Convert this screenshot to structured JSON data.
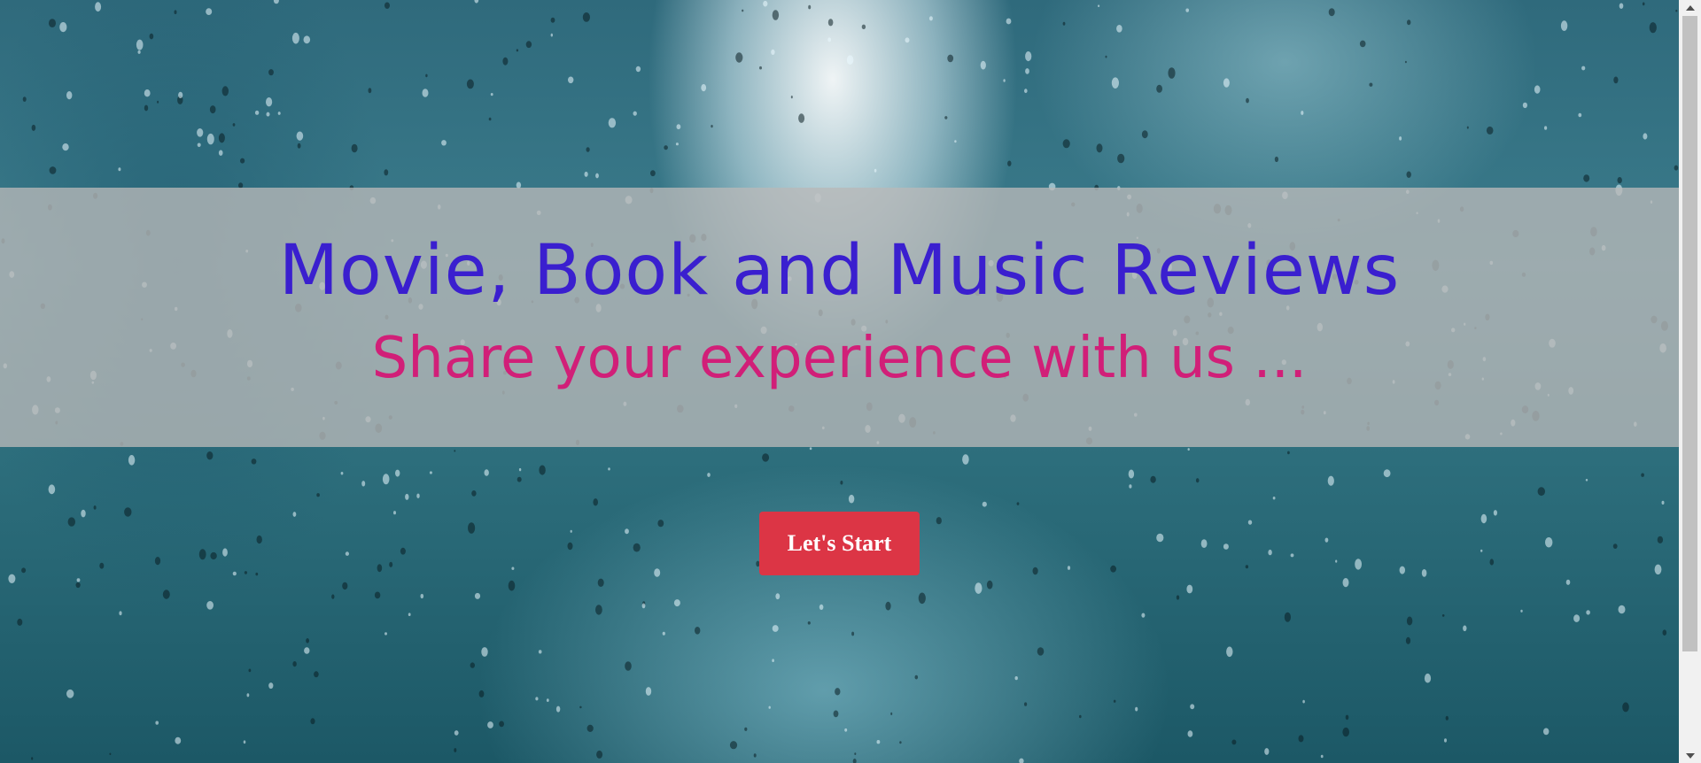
{
  "hero": {
    "title": "Movie, Book and Music Reviews",
    "subtitle": "Share your experience with us ...",
    "background_description_icon": "rainy-street-background",
    "colors": {
      "title": "#3a1fcf",
      "subtitle": "#d11f78",
      "banner": "#b8b8b8"
    }
  },
  "cta": {
    "label": "Let's Start",
    "color": "#dc3545"
  }
}
